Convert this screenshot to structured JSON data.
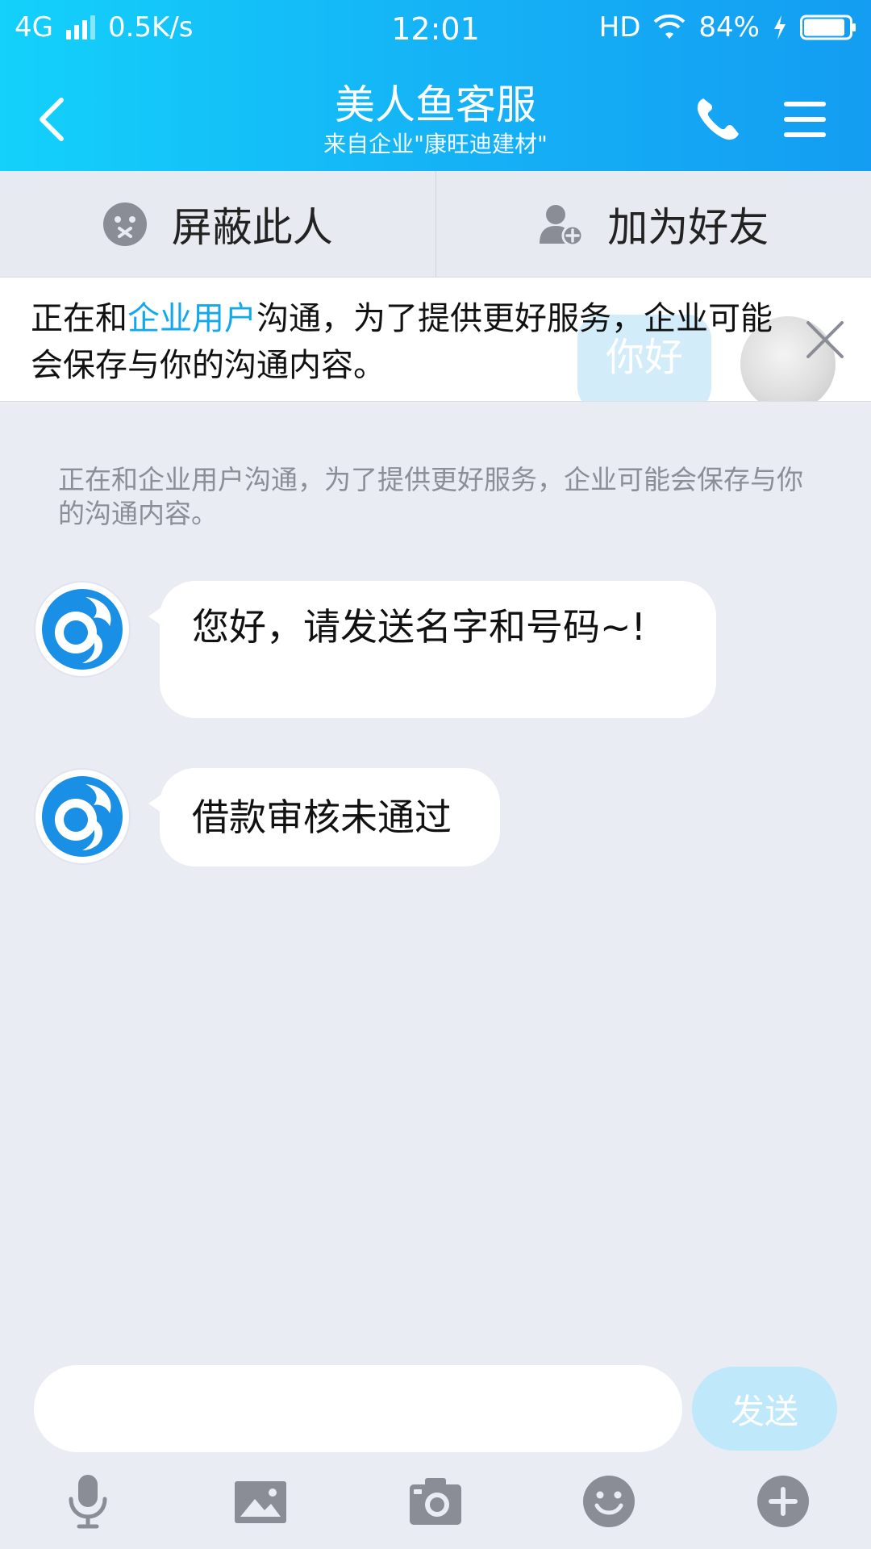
{
  "status_bar": {
    "network": "4G",
    "speed": "0.5K/s",
    "time": "12:01",
    "hd": "HD",
    "battery": "84%"
  },
  "header": {
    "title": "美人鱼客服",
    "subtitle": "来自企业\"康旺迪建材\""
  },
  "actions": {
    "block_label": "屏蔽此人",
    "add_friend_label": "加为好友"
  },
  "notice": {
    "prefix": "正在和",
    "highlight": "企业用户",
    "suffix": "沟通，为了提供更好服务，企业可能会保存与你的沟通内容。",
    "ghost_bubble": "你好"
  },
  "chat": {
    "system_message": "正在和企业用户沟通，为了提供更好服务，企业可能会保存与你的沟通内容。",
    "messages": [
      {
        "text": "您好，请发送名字和号码~!"
      },
      {
        "text": "借款审核未通过"
      }
    ]
  },
  "composer": {
    "send_label": "发送",
    "input_value": ""
  },
  "toolbar": {
    "icons": [
      "microphone-icon",
      "image-icon",
      "camera-icon",
      "emoji-icon",
      "plus-icon"
    ]
  },
  "colors": {
    "header_start": "#13d1fb",
    "header_end": "#149df2",
    "accent": "#12a8ee",
    "background": "#eaecf3",
    "send_disabled": "#bfe9fb"
  }
}
